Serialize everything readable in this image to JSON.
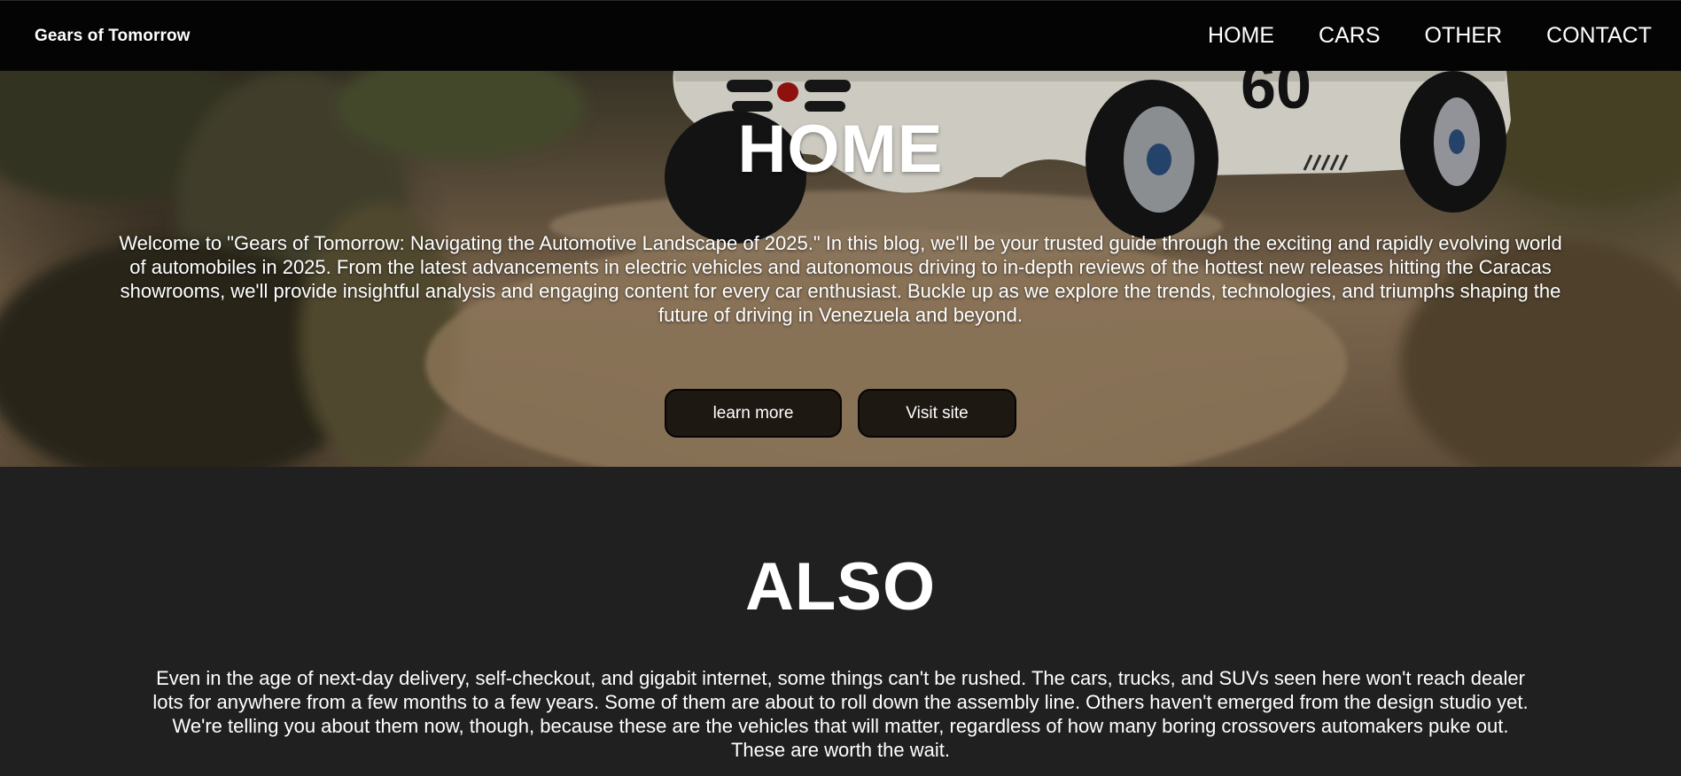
{
  "navbar": {
    "brand": "Gears of Tomorrow",
    "links": [
      "HOME",
      "CARS",
      "OTHER",
      "CONTACT"
    ]
  },
  "hero": {
    "title": "HOME",
    "description": "Welcome to \"Gears of Tomorrow: Navigating the Automotive Landscape of 2025.\" In this blog, we'll be your trusted guide through the exciting and rapidly evolving world of automobiles in 2025. From the latest advancements in electric vehicles and autonomous driving to in-depth reviews of the hottest new releases hitting the Caracas showrooms, we'll provide insightful analysis and engaging content for every car enthusiast. Buckle up as we explore the trends, technologies, and triumphs shaping the future of driving in Venezuela and beyond.",
    "buttons": {
      "learn_more": "learn more",
      "visit_site": "Visit site"
    },
    "car_number": "60"
  },
  "also": {
    "title": "ALSO",
    "description": "Even in the age of next-day delivery, self-checkout, and gigabit internet, some things can't be rushed. The cars, trucks, and SUVs seen here won't reach dealer lots for anywhere from a few months to a few years. Some of them are about to roll down the assembly line. Others haven't emerged from the design studio yet. We're telling you about them now, though, because these are the vehicles that will matter, regardless of how many boring crossovers automakers puke out. These are worth the wait."
  },
  "colors": {
    "navbar_bg": "#040404",
    "page_bg": "#202020",
    "button_bg": "#14100c",
    "text": "#ffffff"
  }
}
